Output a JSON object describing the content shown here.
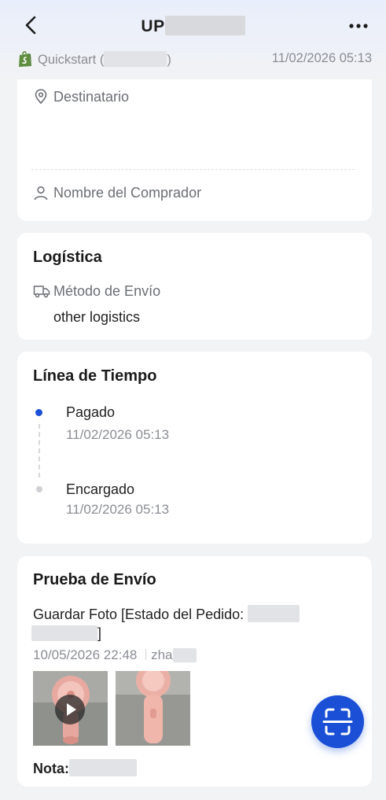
{
  "header": {
    "title_prefix": "UP",
    "shop_label": "Quickstart (",
    "shop_label_end": ")",
    "order_time": "11/02/2026 05:13"
  },
  "address": {
    "recipient_label": "Destinatario",
    "buyer_label": "Nombre del Comprador"
  },
  "logistics": {
    "title": "Logística",
    "method_label": "Método de Envío",
    "method_value": "other logistics"
  },
  "timeline": {
    "title": "Línea de Tiempo",
    "events": [
      {
        "label": "Pagado",
        "time": "11/02/2026 05:13"
      },
      {
        "label": "Encargado",
        "time": "11/02/2026 05:13"
      }
    ]
  },
  "proof": {
    "title": "Prueba de Envío",
    "desc_line1": "Guardar Foto [Estado del Pedido:",
    "desc_line2_end": "]",
    "datetime": "10/05/2026 22:48",
    "operator_prefix": "zha",
    "note_label": "Nota:"
  },
  "colors": {
    "accent": "#1a4fd6",
    "shopify": "#5e8e3e"
  },
  "icons": [
    "back-icon",
    "more-icon",
    "shopify-icon",
    "location-icon",
    "user-icon",
    "truck-icon",
    "play-icon",
    "scan-icon"
  ]
}
